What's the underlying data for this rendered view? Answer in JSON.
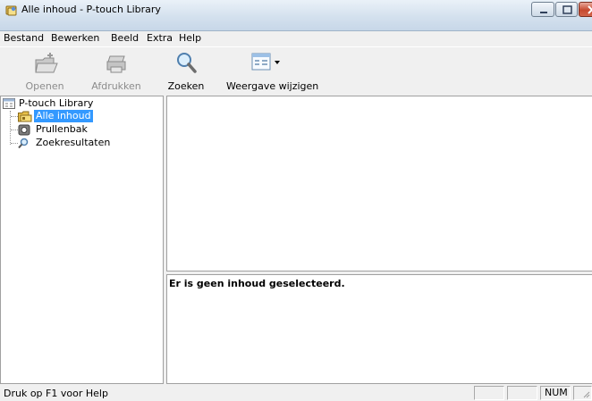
{
  "window": {
    "title": "Alle inhoud - P-touch Library"
  },
  "menu": {
    "items": [
      "Bestand",
      "Bewerken",
      "Beeld",
      "Extra",
      "Help"
    ]
  },
  "toolbar": {
    "open_label": "Openen",
    "print_label": "Afdrukken",
    "search_label": "Zoeken",
    "view_label": "Weergave wijzigen"
  },
  "tree": {
    "root": "P-touch Library",
    "items": [
      "Alle inhoud",
      "Prullenbak",
      "Zoekresultaten"
    ],
    "selected": "Alle inhoud"
  },
  "preview": {
    "message": "Er is geen inhoud geselecteerd."
  },
  "statusbar": {
    "help_text": "Druk op F1 voor Help",
    "num_indicator": "NUM"
  },
  "colors": {
    "selection": "#3399ff",
    "titlebar": "#d4e1ee"
  }
}
